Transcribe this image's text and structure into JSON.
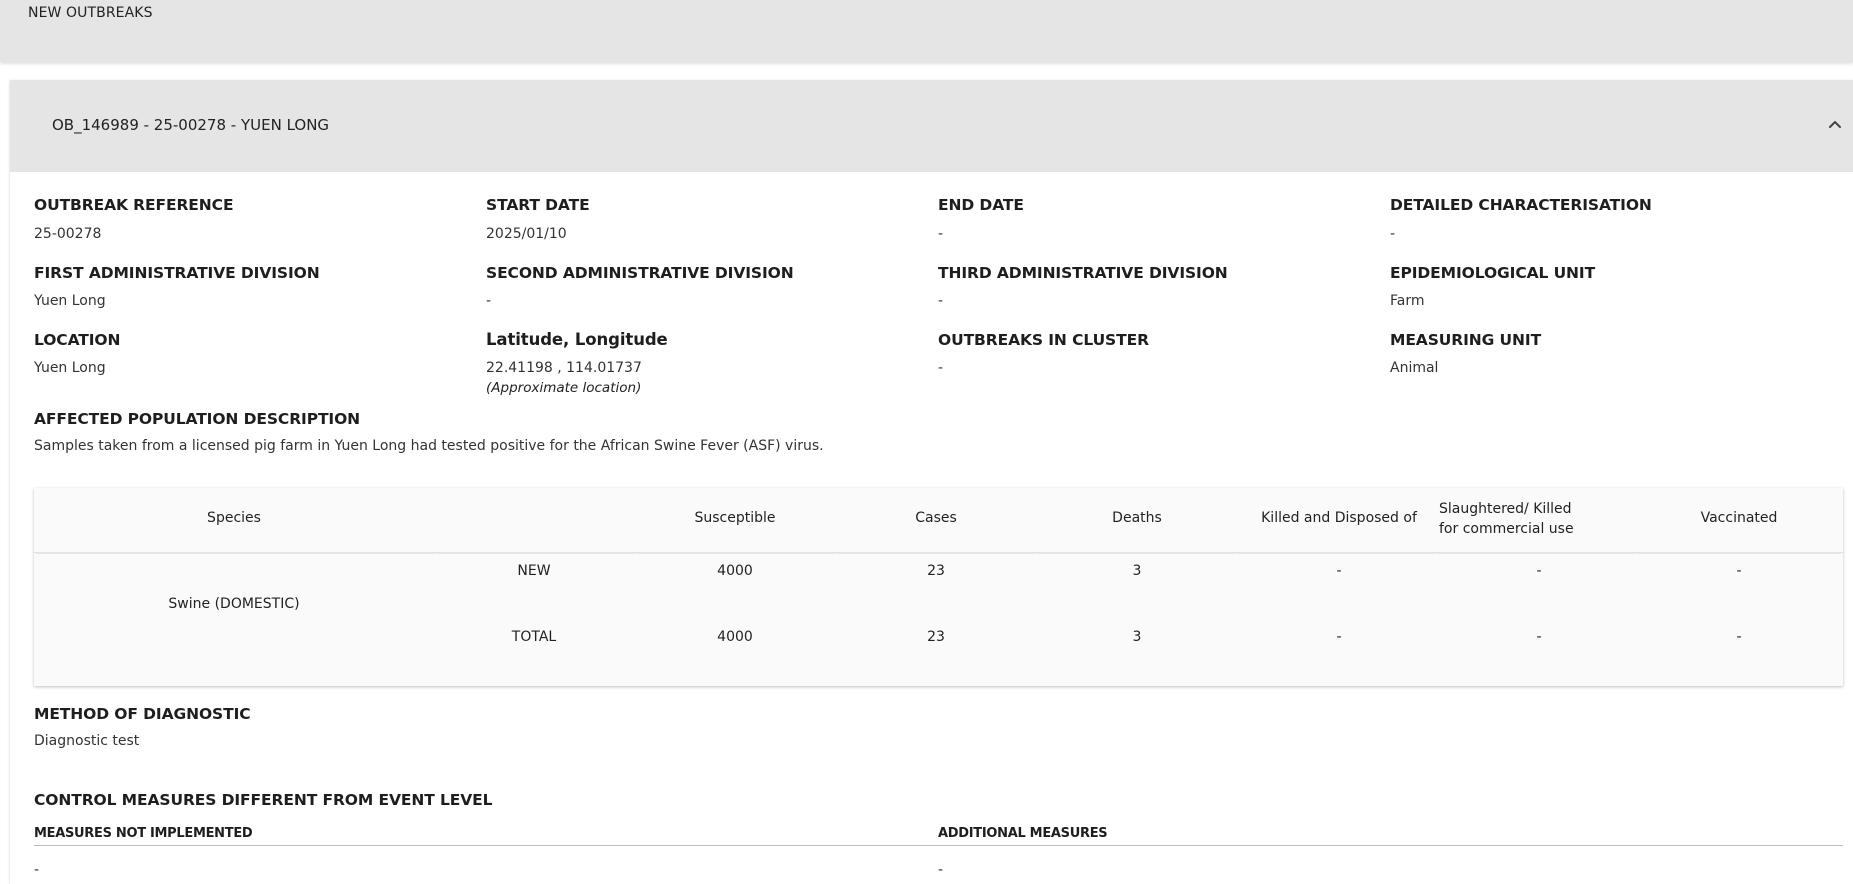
{
  "page": {
    "section_title": "NEW OUTBREAKS"
  },
  "outbreak": {
    "title": "OB_146989 - 25-00278 - YUEN LONG",
    "fields": {
      "outbreak_reference": {
        "label": "OUTBREAK REFERENCE",
        "value": "25-00278"
      },
      "start_date": {
        "label": "START DATE",
        "value": "2025/01/10"
      },
      "end_date": {
        "label": "END DATE",
        "value": "-"
      },
      "detailed_characterisation": {
        "label": "DETAILED CHARACTERISATION",
        "value": "-"
      },
      "first_admin_division": {
        "label": "FIRST ADMINISTRATIVE DIVISION",
        "value": "Yuen Long"
      },
      "second_admin_division": {
        "label": "SECOND ADMINISTRATIVE DIVISION",
        "value": "-"
      },
      "third_admin_division": {
        "label": "THIRD ADMINISTRATIVE DIVISION",
        "value": "-"
      },
      "epidemiological_unit": {
        "label": "EPIDEMIOLOGICAL UNIT",
        "value": "Farm"
      },
      "location": {
        "label": "LOCATION",
        "value": "Yuen Long"
      },
      "lat_long": {
        "label": "Latitude, Longitude",
        "value": "22.41198 , 114.01737",
        "note": "(Approximate location)"
      },
      "outbreaks_in_cluster": {
        "label": "OUTBREAKS IN CLUSTER",
        "value": "-"
      },
      "measuring_unit": {
        "label": "MEASURING UNIT",
        "value": "Animal"
      }
    },
    "affected_population": {
      "label": "AFFECTED POPULATION DESCRIPTION",
      "value": "Samples taken from a licensed pig farm in Yuen Long had tested positive for the African Swine Fever (ASF) virus."
    },
    "table": {
      "headers": {
        "species": "Species",
        "susceptible": "Susceptible",
        "cases": "Cases",
        "deaths": "Deaths",
        "killed_disposed": "Killed and Disposed of",
        "slaughtered": "Slaughtered/ Killed for commercial use",
        "vaccinated": "Vaccinated"
      },
      "species": "Swine (DOMESTIC)",
      "rows": [
        {
          "type": "NEW",
          "susceptible": "4000",
          "cases": "23",
          "deaths": "3",
          "killed_disposed": "-",
          "slaughtered": "-",
          "vaccinated": "-"
        },
        {
          "type": "TOTAL",
          "susceptible": "4000",
          "cases": "23",
          "deaths": "3",
          "killed_disposed": "-",
          "slaughtered": "-",
          "vaccinated": "-"
        }
      ]
    },
    "diagnostic": {
      "label": "METHOD OF DIAGNOSTIC",
      "value": "Diagnostic test"
    },
    "control_measures": {
      "label": "CONTROL MEASURES DIFFERENT FROM EVENT LEVEL",
      "not_implemented": {
        "label": "MEASURES NOT IMPLEMENTED",
        "value": "-"
      },
      "additional": {
        "label": "ADDITIONAL MEASURES",
        "value": "-"
      }
    }
  }
}
